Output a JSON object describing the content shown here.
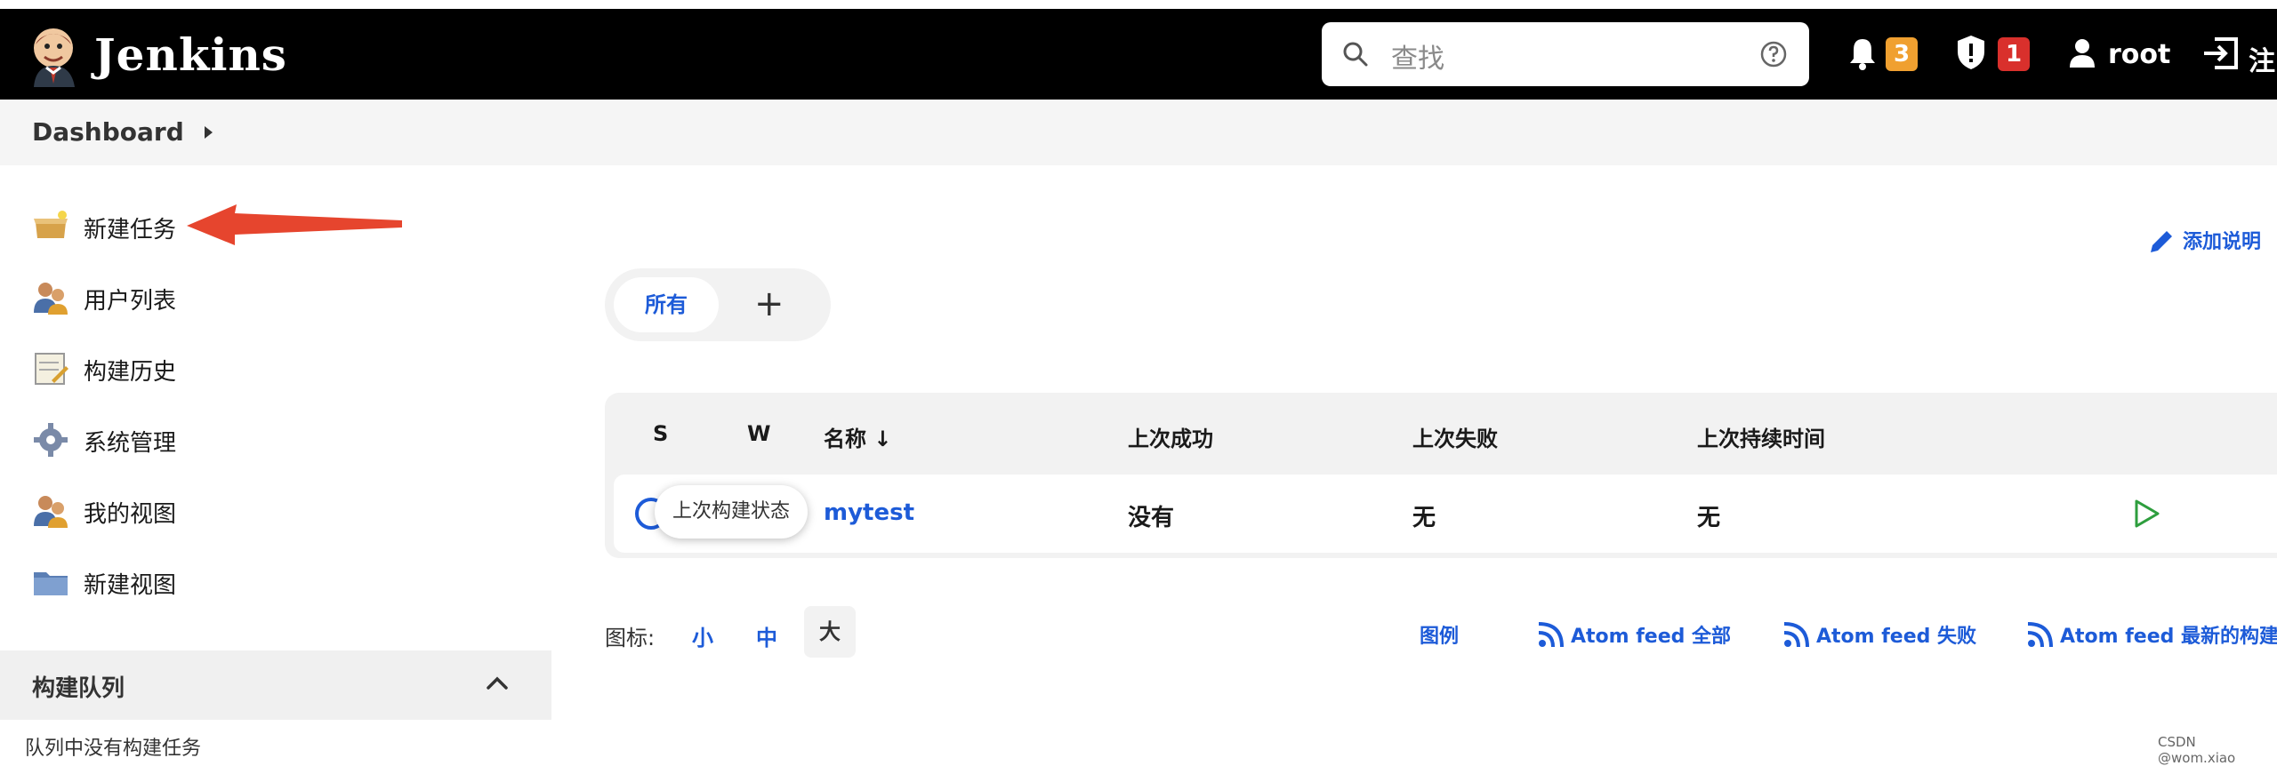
{
  "header": {
    "brand": "Jenkins",
    "search_placeholder": "查找",
    "notifications_count": "3",
    "security_count": "1",
    "user": "root",
    "logout": "注"
  },
  "breadcrumb": {
    "root": "Dashboard"
  },
  "sidebar": {
    "items": [
      {
        "label": "新建任务",
        "icon": "new-item-icon"
      },
      {
        "label": "用户列表",
        "icon": "people-icon"
      },
      {
        "label": "构建历史",
        "icon": "notepad-icon"
      },
      {
        "label": "系统管理",
        "icon": "gear-icon"
      },
      {
        "label": "我的视图",
        "icon": "people-icon"
      },
      {
        "label": "新建视图",
        "icon": "folder-icon"
      }
    ],
    "queue_title": "构建队列",
    "queue_empty": "队列中没有构建任务"
  },
  "main": {
    "add_description": "添加说明",
    "tabs": {
      "all": "所有",
      "add": "+"
    },
    "table": {
      "headers": [
        "S",
        "W",
        "名称 ↓",
        "上次成功",
        "上次失败",
        "上次持续时间"
      ],
      "rows": [
        {
          "name": "mytest",
          "last_success": "没有",
          "last_failure": "无",
          "last_duration": "无",
          "status_tooltip": "上次构建状态"
        }
      ]
    },
    "icon_size_label": "图标:",
    "sizes": [
      "小",
      "中",
      "大"
    ],
    "footer_links": [
      "图例",
      "Atom feed 全部",
      "Atom feed 失败",
      "Atom feed 最新的构建"
    ]
  },
  "watermark": "CSDN @wom.xiao",
  "colors": {
    "accent": "#1d5bd8",
    "notify_badge": "#f0a030",
    "security_badge": "#d9302c",
    "header_bg": "#000000",
    "arrow": "#e6452e"
  }
}
